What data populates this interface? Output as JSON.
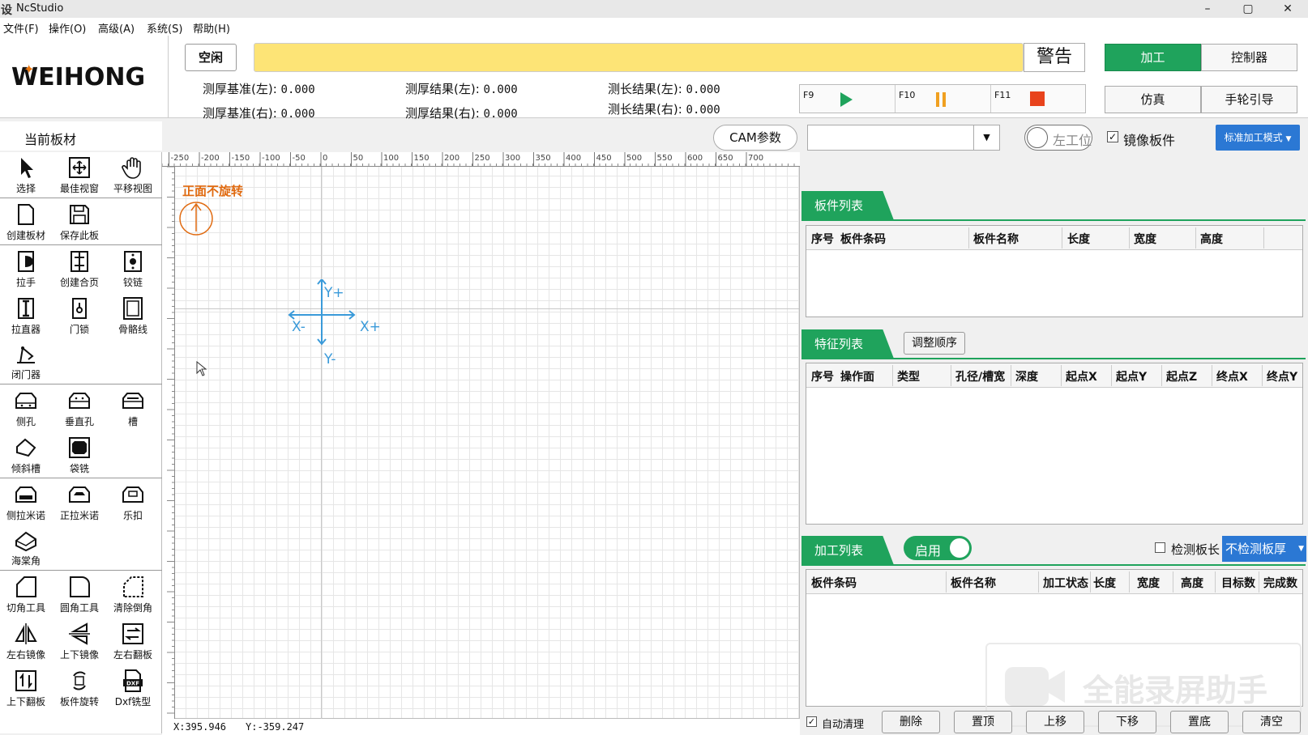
{
  "window": {
    "app_icon": "设",
    "title": "NcStudio",
    "minimize": "–",
    "maximize": "▢",
    "close": "✕"
  },
  "menu": [
    "文件(F)",
    "操作(O)",
    "高级(A)",
    "系统(S)",
    "帮助(H)"
  ],
  "logo": "WEIHONG",
  "state_label": "空闲",
  "warning_label": "警告",
  "measure": {
    "thick_ref_left_label": "测厚基准(左):",
    "thick_ref_left": "0.000",
    "thick_ref_right_label": "测厚基准(右):",
    "thick_ref_right": "0.000",
    "thick_res_left_label": "测厚结果(左):",
    "thick_res_left": "0.000",
    "thick_res_right_label": "测厚结果(右):",
    "thick_res_right": "0.000",
    "len_res_left_label": "测长结果(左):",
    "len_res_left": "0.000",
    "len_res_right_label": "测长结果(右):",
    "len_res_right": "0.000"
  },
  "fkeys": {
    "f9": "F9",
    "f10": "F10",
    "f11": "F11"
  },
  "top_tabs": {
    "process": "加工",
    "controller": "控制器",
    "simulate": "仿真",
    "handwheel": "手轮引导"
  },
  "colors": {
    "green": "#1fa35c",
    "blue": "#2b78d4",
    "alarm_yellow": "#fde476",
    "orange": "#e06a10",
    "axis_blue": "#3a9ad9",
    "stop_red": "#e8431c"
  },
  "current_board": "当前板材",
  "cam_params": "CAM参数",
  "left_station": "左工位",
  "mirror_board": "镜像板件",
  "process_mode": "标准加工模式",
  "tools": [
    "选择",
    "最佳视窗",
    "平移视图",
    "创建板材",
    "保存此板",
    "拉手",
    "创建合页",
    "铰链",
    "拉直器",
    "门锁",
    "骨骼线",
    "闭门器",
    "侧孔",
    "垂直孔",
    "槽",
    "倾斜槽",
    "袋铣",
    "侧拉米诺",
    "正拉米诺",
    "乐扣",
    "海棠角",
    "切角工具",
    "圆角工具",
    "清除倒角",
    "左右镜像",
    "上下镜像",
    "左右翻板",
    "上下翻板",
    "板件旋转",
    "Dxf铣型"
  ],
  "canvas": {
    "orientation": "正面不旋转",
    "axes": {
      "yplus": "Y+",
      "yminus": "Y-",
      "xplus": "X+",
      "xminus": "X-"
    },
    "ruler_ticks": [
      "-250",
      "-200",
      "-150",
      "-100",
      "-50",
      "0",
      "50",
      "100",
      "150",
      "200",
      "250",
      "300",
      "350",
      "400",
      "450",
      "500",
      "550",
      "600",
      "650",
      "700"
    ]
  },
  "status": {
    "x": "X:395.946",
    "y": "Y:-359.247"
  },
  "board_list": {
    "title": "板件列表",
    "columns": [
      "序号",
      "板件条码",
      "板件名称",
      "长度",
      "宽度",
      "高度"
    ]
  },
  "feature_list": {
    "title": "特征列表",
    "reorder": "调整顺序",
    "columns": [
      "序号",
      "操作面",
      "类型",
      "孔径/槽宽",
      "深度",
      "起点X",
      "起点Y",
      "起点Z",
      "终点X",
      "终点Y"
    ]
  },
  "process_list": {
    "title": "加工列表",
    "enable": "启用",
    "detect_len": "检测板长",
    "thick_mode": "不检测板厚",
    "columns": [
      "板件条码",
      "板件名称",
      "加工状态",
      "长度",
      "宽度",
      "高度",
      "目标数",
      "完成数"
    ]
  },
  "bottom_actions": {
    "auto_clean": "自动清理",
    "delete": "删除",
    "top": "置顶",
    "up": "上移",
    "down": "下移",
    "bottom": "置底",
    "clear": "清空"
  },
  "watermark": "全能录屏助手"
}
